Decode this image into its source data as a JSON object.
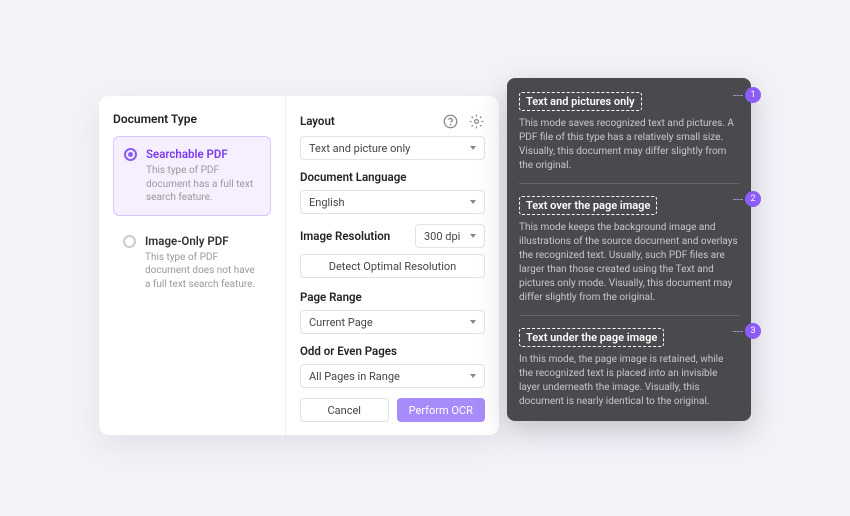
{
  "left": {
    "title": "Document Type",
    "items": [
      {
        "label": "Searchable PDF",
        "desc": "This type of PDF document has a full text search feature."
      },
      {
        "label": "Image-Only PDF",
        "desc": "This type of PDF document does not have a full text search feature."
      }
    ]
  },
  "right": {
    "layout_label": "Layout",
    "layout_value": "Text and picture only",
    "lang_label": "Document Language",
    "lang_value": "English",
    "res_label": "Image Resolution",
    "res_value": "300 dpi",
    "detect_btn": "Detect Optimal Resolution",
    "range_label": "Page Range",
    "range_value": "Current Page",
    "oddeven_label": "Odd or Even Pages",
    "oddeven_value": "All Pages in Range",
    "cancel": "Cancel",
    "perform": "Perform OCR"
  },
  "tooltip": {
    "items": [
      {
        "num": "1",
        "title": "Text and pictures only",
        "desc": "This mode saves recognized text and pictures. A PDF file of this type has a relatively small size. Visually, this document may differ slightly from the original."
      },
      {
        "num": "2",
        "title": "Text over the page image",
        "desc": "This mode keeps the background image and illustrations of the source document and overlays the recognized text. Usually, such PDF files are larger than those created using the Text and pictures only mode. Visually, this document may differ slightly from the original."
      },
      {
        "num": "3",
        "title": "Text under the page image",
        "desc": "In this mode, the page image is retained, while the recognized text is placed into an invisible layer underneath the image. Visually, this document is nearly identical to the original."
      }
    ]
  }
}
